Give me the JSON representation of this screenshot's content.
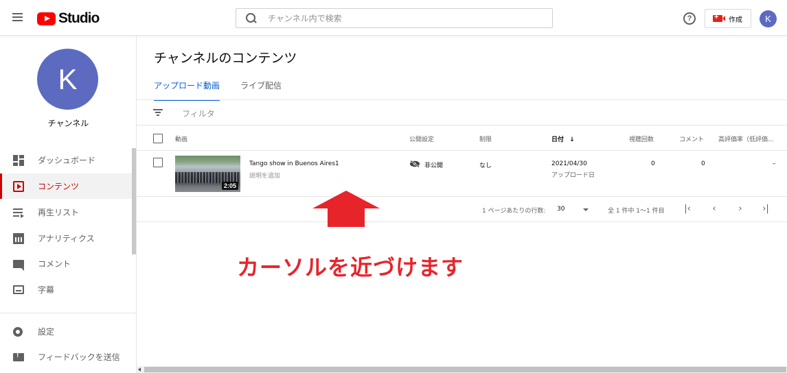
{
  "header": {
    "logo_text": "Studio",
    "search_placeholder": "チャンネル内で検索",
    "help_label": "?",
    "create_label": "作成",
    "avatar_letter": "K"
  },
  "sidebar": {
    "avatar_letter": "K",
    "channel_name": "チャンネル",
    "items": [
      {
        "label": "ダッシュボード",
        "icon": "dashboard-icon"
      },
      {
        "label": "コンテンツ",
        "icon": "content-icon",
        "active": true
      },
      {
        "label": "再生リスト",
        "icon": "playlist-icon"
      },
      {
        "label": "アナリティクス",
        "icon": "analytics-icon"
      },
      {
        "label": "コメント",
        "icon": "comment-icon"
      },
      {
        "label": "字幕",
        "icon": "subtitles-icon"
      }
    ],
    "bottom_items": [
      {
        "label": "設定",
        "icon": "gear-icon"
      },
      {
        "label": "フィードバックを送信",
        "icon": "feedback-icon"
      }
    ]
  },
  "main": {
    "title": "チャンネルのコンテンツ",
    "tabs": [
      {
        "label": "アップロード動画",
        "active": true
      },
      {
        "label": "ライブ配信",
        "active": false
      }
    ],
    "filter_label": "フィルタ",
    "columns": {
      "video": "動画",
      "visibility": "公開設定",
      "restrictions": "制限",
      "date": "日付",
      "date_sort_icon": "↓",
      "views": "視聴回数",
      "comments": "コメント",
      "likes": "高評価率（低評価..."
    },
    "rows": [
      {
        "duration": "2:05",
        "title": "Tango show in Buenos Aires1",
        "description": "説明を追加",
        "visibility": "非公開",
        "restrictions": "なし",
        "date": "2021/04/30",
        "date_sub": "アップロード日",
        "views": "0",
        "comments": "0",
        "likes": "–"
      }
    ],
    "pagination": {
      "rows_per_page_label": "1 ページあたりの行数:",
      "rows_per_page": "30",
      "range_text": "全 1 件中 1〜1 件目",
      "first": "|‹",
      "prev": "‹",
      "next": "›",
      "last": "›|"
    }
  },
  "annotation": {
    "text": "カーソルを近づけます",
    "color": "#e8242b"
  },
  "colors": {
    "brand_red": "#ff0000",
    "active_red": "#cc0000",
    "link_blue": "#065fd4",
    "avatar": "#5c6bc0"
  }
}
